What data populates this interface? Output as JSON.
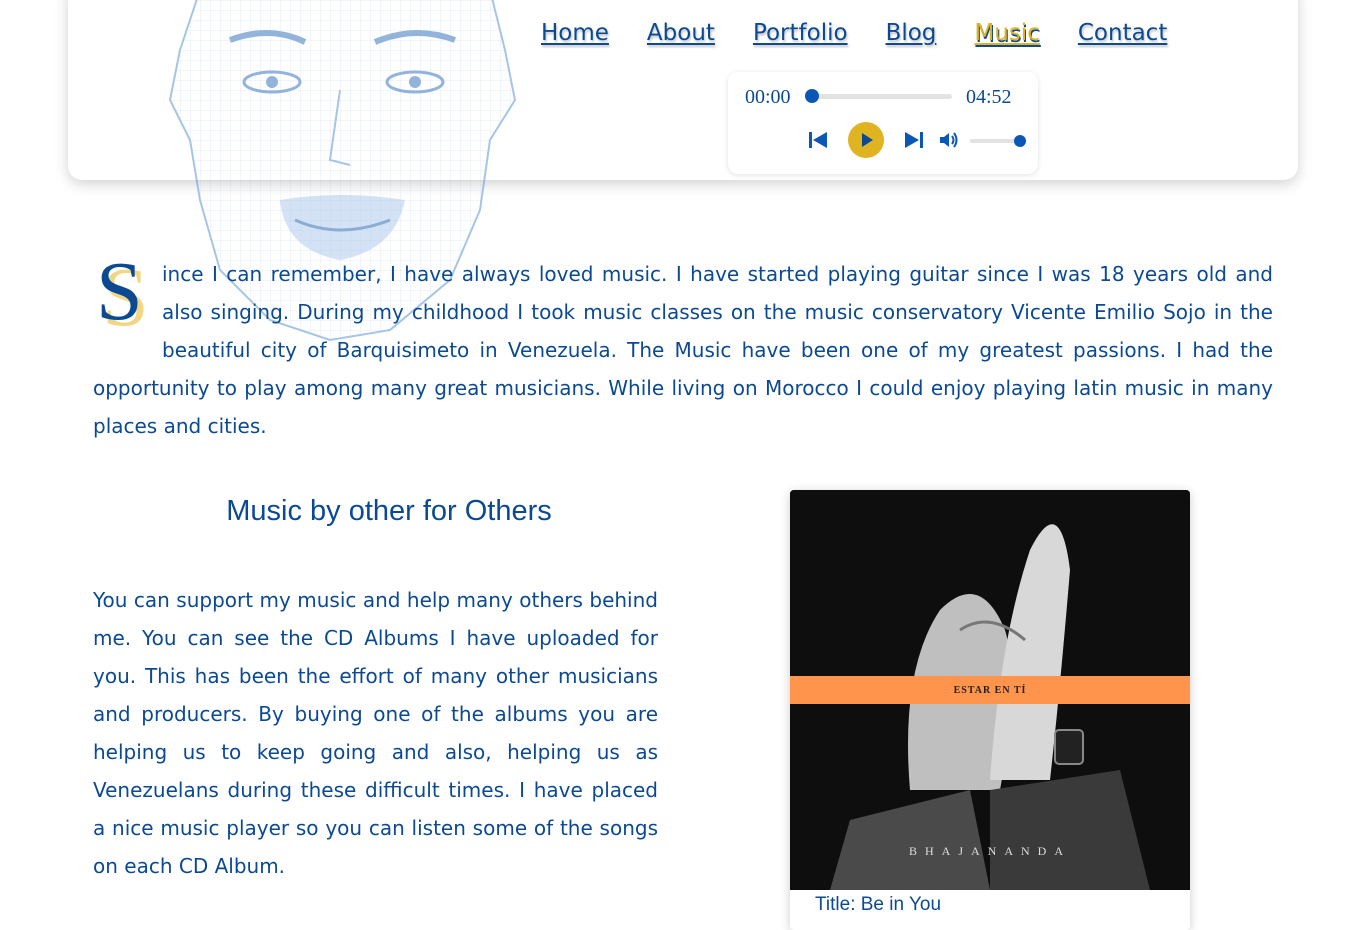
{
  "nav": {
    "items": [
      "Home",
      "About",
      "Portfolio",
      "Blog",
      "Music",
      "Contact"
    ],
    "active": "Music"
  },
  "player": {
    "current_time": "00:00",
    "duration": "04:52",
    "progress": 0,
    "volume": 1,
    "icons": [
      "skip-back-icon",
      "play-icon",
      "skip-forward-icon",
      "volume-icon"
    ]
  },
  "intro": {
    "dropcap": "S",
    "text": "ince I can remember, I have always loved music. I have started playing guitar since I was 18 years old and also singing. During my childhood I took music classes on the music conservatory Vicente Emilio Sojo in the beautiful city of Barquisimeto in Venezuela. The Music have been one of my greatest passions. I had the opportunity to play among many great musicians. While living on Morocco I could enjoy playing latin music in many places and cities."
  },
  "section": {
    "heading": "Music by other for Others",
    "text": "You can support my music and help many others behind me. You can see the CD Albums I have uploaded for you. This has been the effort of many other musicians and producers. By buying one of the albums you are helping us to keep going and also, helping us as Venezuelans during these difficult times. I have placed a nice music player so you can listen some of the songs on each CD Album."
  },
  "album": {
    "cover_title": "ESTAR EN TÍ",
    "cover_artist": "BHAJANANDA",
    "caption": "Title: Be in You"
  },
  "colors": {
    "primary": "#0b4a93",
    "accent": "#e0b320",
    "band": "#ff944d"
  }
}
